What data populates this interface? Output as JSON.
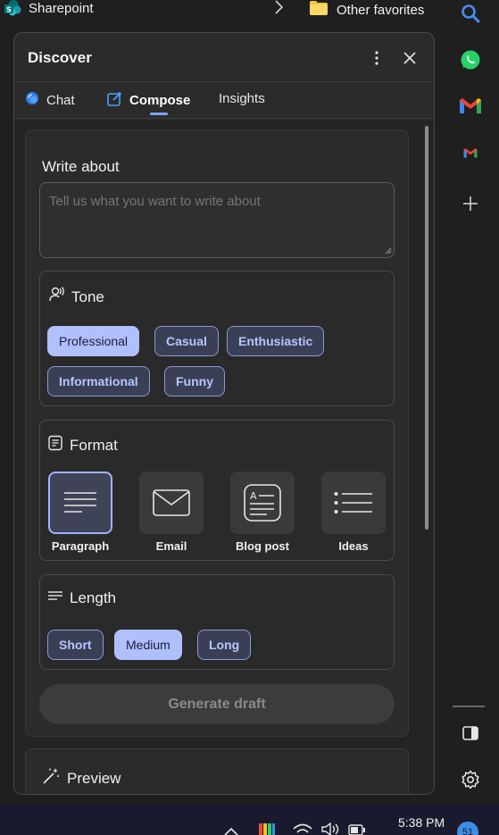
{
  "favorites": {
    "sharepoint": "Sharepoint",
    "other": "Other favorites"
  },
  "panel": {
    "title": "Discover",
    "tabs": [
      {
        "label": "Chat",
        "icon": "copilot-chat-icon"
      },
      {
        "label": "Compose",
        "icon": "compose-edit-icon",
        "active": true
      },
      {
        "label": "Insights"
      }
    ]
  },
  "compose": {
    "write_label": "Write about",
    "write_placeholder": "Tell us what you want to write about",
    "tone": {
      "title": "Tone",
      "options": [
        "Professional",
        "Casual",
        "Enthusiastic",
        "Informational",
        "Funny"
      ],
      "selected": "Professional"
    },
    "format": {
      "title": "Format",
      "options": [
        "Paragraph",
        "Email",
        "Blog post",
        "Ideas"
      ],
      "selected": "Paragraph"
    },
    "length": {
      "title": "Length",
      "options": [
        "Short",
        "Medium",
        "Long"
      ],
      "selected": "Medium"
    },
    "generate_label": "Generate draft"
  },
  "preview": {
    "title": "Preview"
  },
  "taskbar": {
    "time": "5:38 PM",
    "badge": "51"
  },
  "colors": {
    "accent": "#b0c0ff",
    "chip_border": "#8899d6",
    "panel_bg": "#2b2b2b"
  }
}
